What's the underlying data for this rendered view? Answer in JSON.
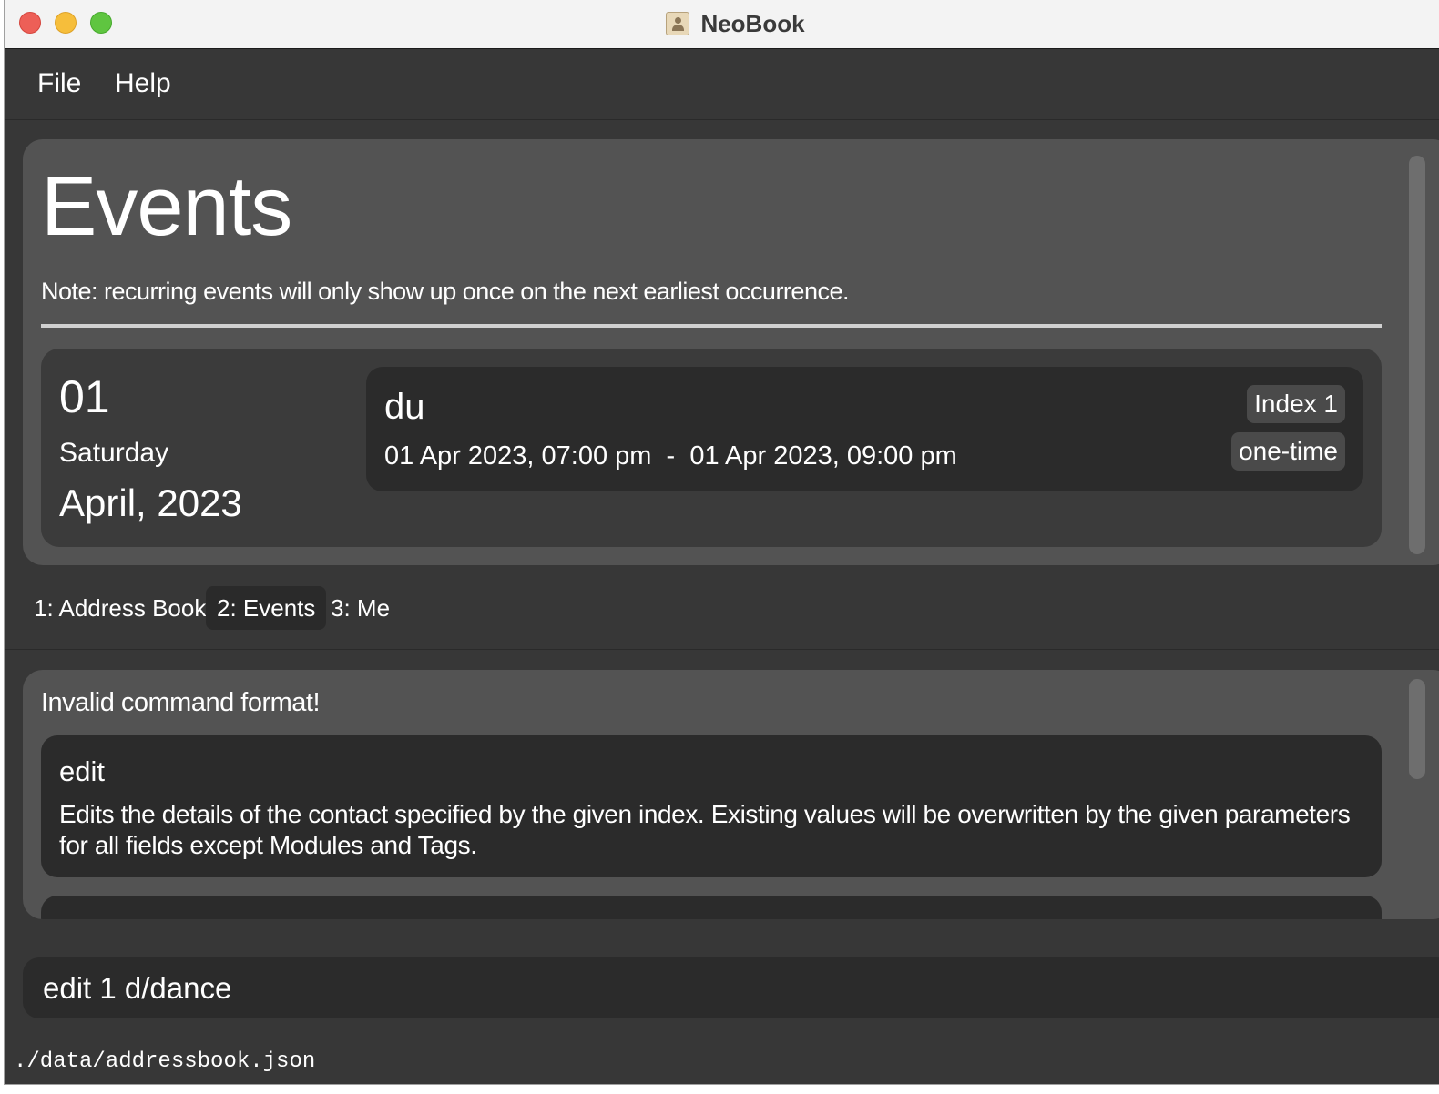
{
  "window": {
    "title": "NeoBook",
    "app_icon": "contact-book-icon"
  },
  "menu": {
    "file": "File",
    "help": "Help"
  },
  "events": {
    "heading": "Events",
    "note": "Note: recurring events will only show up once on the next earliest occurrence.",
    "days": [
      {
        "day_number": "01",
        "weekday": "Saturday",
        "month_year": "April, 2023",
        "items": [
          {
            "name": "du",
            "time_range": "01 Apr 2023, 07:00 pm  -  01 Apr 2023, 09:00 pm",
            "index_label": "Index 1",
            "recurrence": "one-time"
          }
        ]
      }
    ]
  },
  "tabs": [
    {
      "label": "1: Address Book",
      "active": false
    },
    {
      "label": "2: Events",
      "active": true
    },
    {
      "label": "3: Me",
      "active": false
    }
  ],
  "result": {
    "message": "Invalid command format!",
    "help_command": "edit",
    "help_description": "Edits the details of the contact specified by the given index. Existing values will be overwritten by the given parameters for all fields except Modules and Tags."
  },
  "command_input": {
    "value": "edit 1 d/dance"
  },
  "status": {
    "path": "./data/addressbook.json"
  }
}
